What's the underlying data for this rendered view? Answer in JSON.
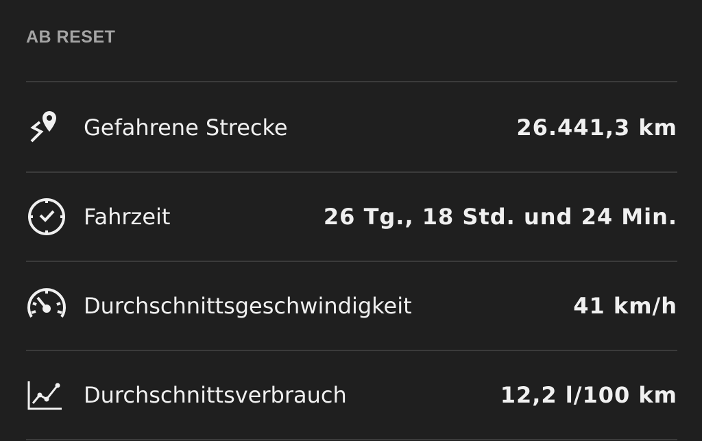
{
  "section": {
    "title": "AB RESET"
  },
  "rows": [
    {
      "label": "Gefahrene Strecke",
      "value": "26.441,3 km",
      "icon": "route-pin-icon"
    },
    {
      "label": "Fahrzeit",
      "value": "26 Tg., 18 Std. und 24 Min.",
      "icon": "clock-icon"
    },
    {
      "label": "Durchschnittsgeschwindigkeit",
      "value": "41 km/h",
      "icon": "speedometer-icon"
    },
    {
      "label": "Durchschnittsverbrauch",
      "value": "12,2 l/100 km",
      "icon": "consumption-chart-icon"
    }
  ],
  "colors": {
    "background": "#1f1f1f",
    "text": "#f0f0f0",
    "header": "#a4a4a4",
    "divider": "#3b3b3b"
  }
}
